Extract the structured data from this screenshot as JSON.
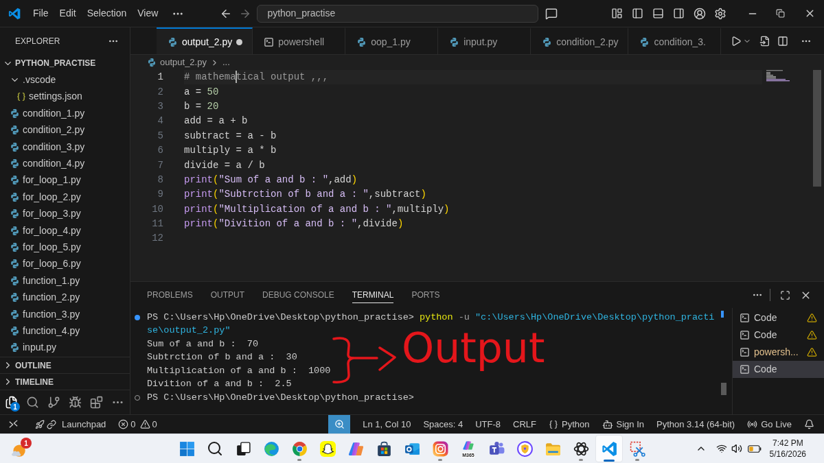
{
  "title_bar": {
    "menu": [
      {
        "label": "File"
      },
      {
        "label": "Edit"
      },
      {
        "label": "Selection"
      },
      {
        "label": "View"
      }
    ],
    "search": {
      "value": "python_practise"
    }
  },
  "sidebar": {
    "title": "EXPLORER",
    "tree": [
      {
        "label": "PYTHON_PRACTISE",
        "kind": "root",
        "expanded": true,
        "children": [
          {
            "label": ".vscode",
            "kind": "folder",
            "expanded": true,
            "children": [
              {
                "label": "settings.json",
                "kind": "json"
              }
            ]
          },
          {
            "label": "condition_1.py",
            "kind": "python"
          },
          {
            "label": "condition_2.py",
            "kind": "python"
          },
          {
            "label": "condition_3.py",
            "kind": "python"
          },
          {
            "label": "condition_4.py",
            "kind": "python"
          },
          {
            "label": "for_loop_1.py",
            "kind": "python"
          },
          {
            "label": "for_loop_2.py",
            "kind": "python"
          },
          {
            "label": "for_loop_3.py",
            "kind": "python"
          },
          {
            "label": "for_loop_4.py",
            "kind": "python"
          },
          {
            "label": "for_loop_5.py",
            "kind": "python"
          },
          {
            "label": "for_loop_6.py",
            "kind": "python"
          },
          {
            "label": "function_1.py",
            "kind": "python"
          },
          {
            "label": "function_2.py",
            "kind": "python"
          },
          {
            "label": "function_3.py",
            "kind": "python"
          },
          {
            "label": "function_4.py",
            "kind": "python"
          },
          {
            "label": "input.py",
            "kind": "python"
          }
        ]
      }
    ],
    "sections": [
      {
        "label": "OUTLINE",
        "expanded": false
      },
      {
        "label": "TIMELINE",
        "expanded": false
      }
    ],
    "activity": [
      {
        "kind": "explorer",
        "selected": true,
        "badge": "1"
      },
      {
        "kind": "search",
        "selected": false
      },
      {
        "kind": "source_control",
        "selected": false
      },
      {
        "kind": "run_debug",
        "selected": false
      },
      {
        "kind": "extensions",
        "selected": false
      },
      {
        "kind": "more",
        "selected": false
      }
    ]
  },
  "editor": {
    "tabs": [
      {
        "label": "output_2.py",
        "kind": "python",
        "selected": true,
        "modified": true
      },
      {
        "label": "powershell",
        "kind": "terminal",
        "selected": false,
        "modified": false
      },
      {
        "label": "oop_1.py",
        "kind": "python",
        "selected": false,
        "modified": false
      },
      {
        "label": "input.py",
        "kind": "python",
        "selected": false,
        "modified": false
      },
      {
        "label": "condition_2.py",
        "kind": "python",
        "selected": false,
        "modified": false
      },
      {
        "label": "condition_3.",
        "kind": "python",
        "selected": false,
        "modified": false
      }
    ],
    "breadcrumb": [
      {
        "label": "output_2.py",
        "kind": "python"
      },
      {
        "label": "...",
        "kind": "more"
      }
    ],
    "lines": [
      {
        "number": "1",
        "current": true,
        "tokens": [
          {
            "kind": "comment",
            "text": "# mathema"
          },
          {
            "kind": "cursor"
          },
          {
            "kind": "comment",
            "text": "tical output ,,,"
          }
        ]
      },
      {
        "number": "2",
        "current": false,
        "tokens": [
          {
            "kind": "plain",
            "text": "a = "
          },
          {
            "kind": "number",
            "text": "50"
          }
        ]
      },
      {
        "number": "3",
        "current": false,
        "tokens": [
          {
            "kind": "plain",
            "text": "b = "
          },
          {
            "kind": "number",
            "text": "20"
          }
        ]
      },
      {
        "number": "4",
        "current": false,
        "tokens": [
          {
            "kind": "plain",
            "text": "add = a + b"
          }
        ]
      },
      {
        "number": "5",
        "current": false,
        "tokens": [
          {
            "kind": "plain",
            "text": "subtract = a - b"
          }
        ]
      },
      {
        "number": "6",
        "current": false,
        "tokens": [
          {
            "kind": "plain",
            "text": "multiply = a * b"
          }
        ]
      },
      {
        "number": "7",
        "current": false,
        "tokens": [
          {
            "kind": "plain",
            "text": "divide = a / b"
          }
        ]
      },
      {
        "number": "8",
        "current": false,
        "tokens": [
          {
            "kind": "function",
            "text": "print"
          },
          {
            "kind": "paren",
            "text": "("
          },
          {
            "kind": "string",
            "text": "\"Sum of a and b : \""
          },
          {
            "kind": "plain",
            "text": ",add"
          },
          {
            "kind": "paren",
            "text": ")"
          }
        ]
      },
      {
        "number": "9",
        "current": false,
        "tokens": [
          {
            "kind": "function",
            "text": "print"
          },
          {
            "kind": "paren",
            "text": "("
          },
          {
            "kind": "string",
            "text": "\"Subtrction of b and a : \""
          },
          {
            "kind": "plain",
            "text": ",subtract"
          },
          {
            "kind": "paren",
            "text": ")"
          }
        ]
      },
      {
        "number": "10",
        "current": false,
        "tokens": [
          {
            "kind": "function",
            "text": "print"
          },
          {
            "kind": "paren",
            "text": "("
          },
          {
            "kind": "string",
            "text": "\"Multiplication of a and b : \""
          },
          {
            "kind": "plain",
            "text": ",multiply"
          },
          {
            "kind": "paren",
            "text": ")"
          }
        ]
      },
      {
        "number": "11",
        "current": false,
        "tokens": [
          {
            "kind": "function",
            "text": "print"
          },
          {
            "kind": "paren",
            "text": "("
          },
          {
            "kind": "string",
            "text": "\"Divition of a and b : \""
          },
          {
            "kind": "plain",
            "text": ",divide"
          },
          {
            "kind": "paren",
            "text": ")"
          }
        ]
      },
      {
        "number": "12",
        "current": false
      }
    ]
  },
  "panel": {
    "tabs": [
      {
        "label": "PROBLEMS",
        "selected": false
      },
      {
        "label": "OUTPUT",
        "selected": false
      },
      {
        "label": "DEBUG CONSOLE",
        "selected": false
      },
      {
        "label": "TERMINAL",
        "selected": true
      },
      {
        "label": "PORTS",
        "selected": false
      }
    ],
    "terminal": [
      {
        "kind": "success",
        "tokens": [
          {
            "kind": "prompt",
            "text": "PS C:\\Users\\Hp\\OneDrive\\Desktop\\python_practise> "
          },
          {
            "kind": "command",
            "text": "python"
          },
          {
            "kind": "flag",
            "text": " -u "
          },
          {
            "kind": "path",
            "text": "\"c:\\Users\\Hp\\OneDrive\\Desktop\\python_practi"
          }
        ]
      },
      {
        "kind": "plain",
        "tokens": [
          {
            "kind": "path",
            "text": "se\\output_2.py\""
          }
        ]
      },
      {
        "kind": "plain",
        "tokens": [
          {
            "kind": "output",
            "text": "Sum of a and b :  70"
          }
        ]
      },
      {
        "kind": "plain",
        "tokens": [
          {
            "kind": "output",
            "text": "Subtrction of b and a :  30"
          }
        ]
      },
      {
        "kind": "plain",
        "tokens": [
          {
            "kind": "output",
            "text": "Multiplication of a and b :  1000"
          }
        ]
      },
      {
        "kind": "plain",
        "tokens": [
          {
            "kind": "output",
            "text": "Divition of a and b :  2.5"
          }
        ]
      },
      {
        "kind": "pending",
        "tokens": [
          {
            "kind": "prompt",
            "text": "PS C:\\Users\\Hp\\OneDrive\\Desktop\\python_practise>"
          }
        ]
      }
    ],
    "instances": [
      {
        "label": "Code",
        "color": "#cccccc",
        "warning": true,
        "selected": false
      },
      {
        "label": "Code",
        "color": "#cccccc",
        "warning": true,
        "selected": false
      },
      {
        "label": "powersh...",
        "color": "#e2c08d",
        "warning": true,
        "selected": false
      },
      {
        "label": "Code",
        "color": "#cccccc",
        "warning": false,
        "selected": true
      }
    ]
  },
  "annotation": {
    "text": "Output"
  },
  "status_bar": {
    "launchpad": "Launchpad",
    "errors": "0",
    "warnings": "0",
    "items": [
      {
        "kind": "zoom",
        "highlighted": true
      },
      {
        "kind": "text",
        "label": "Ln 1, Col 10"
      },
      {
        "kind": "text",
        "label": "Spaces: 4"
      },
      {
        "kind": "text",
        "label": "UTF-8"
      },
      {
        "kind": "text",
        "label": "CRLF"
      },
      {
        "kind": "language",
        "label": "Python"
      },
      {
        "kind": "account",
        "label": "Sign In"
      },
      {
        "kind": "text",
        "label": "Python 3.14 (64-bit)"
      },
      {
        "kind": "live",
        "label": "Go Live"
      },
      {
        "kind": "bell"
      }
    ]
  },
  "taskbar": {
    "widget_badge": "1",
    "apps": [
      {
        "kind": "start",
        "running": false,
        "active": false
      },
      {
        "kind": "search",
        "running": false,
        "active": false
      },
      {
        "kind": "task_view",
        "running": false,
        "active": false
      },
      {
        "kind": "edge",
        "running": false,
        "active": false
      },
      {
        "kind": "chrome",
        "running": true,
        "active": false
      },
      {
        "kind": "snapchat",
        "running": false,
        "active": false
      },
      {
        "kind": "copilot",
        "running": false,
        "active": false
      },
      {
        "kind": "store",
        "running": false,
        "active": false
      },
      {
        "kind": "outlook",
        "running": false,
        "active": false
      },
      {
        "kind": "instagram",
        "running": true,
        "active": false
      },
      {
        "kind": "m365",
        "label": "M365",
        "running": false,
        "active": false
      },
      {
        "kind": "teams",
        "running": false,
        "active": false
      },
      {
        "kind": "vpn",
        "running": false,
        "active": false
      },
      {
        "kind": "files",
        "running": false,
        "active": false
      },
      {
        "kind": "chatgpt",
        "running": true,
        "active": false
      },
      {
        "kind": "vscode",
        "running": true,
        "active": true
      },
      {
        "kind": "snipping",
        "running": true,
        "active": false
      }
    ],
    "clock": {
      "time": "7:42 PM",
      "date": "5/16/2026"
    }
  }
}
